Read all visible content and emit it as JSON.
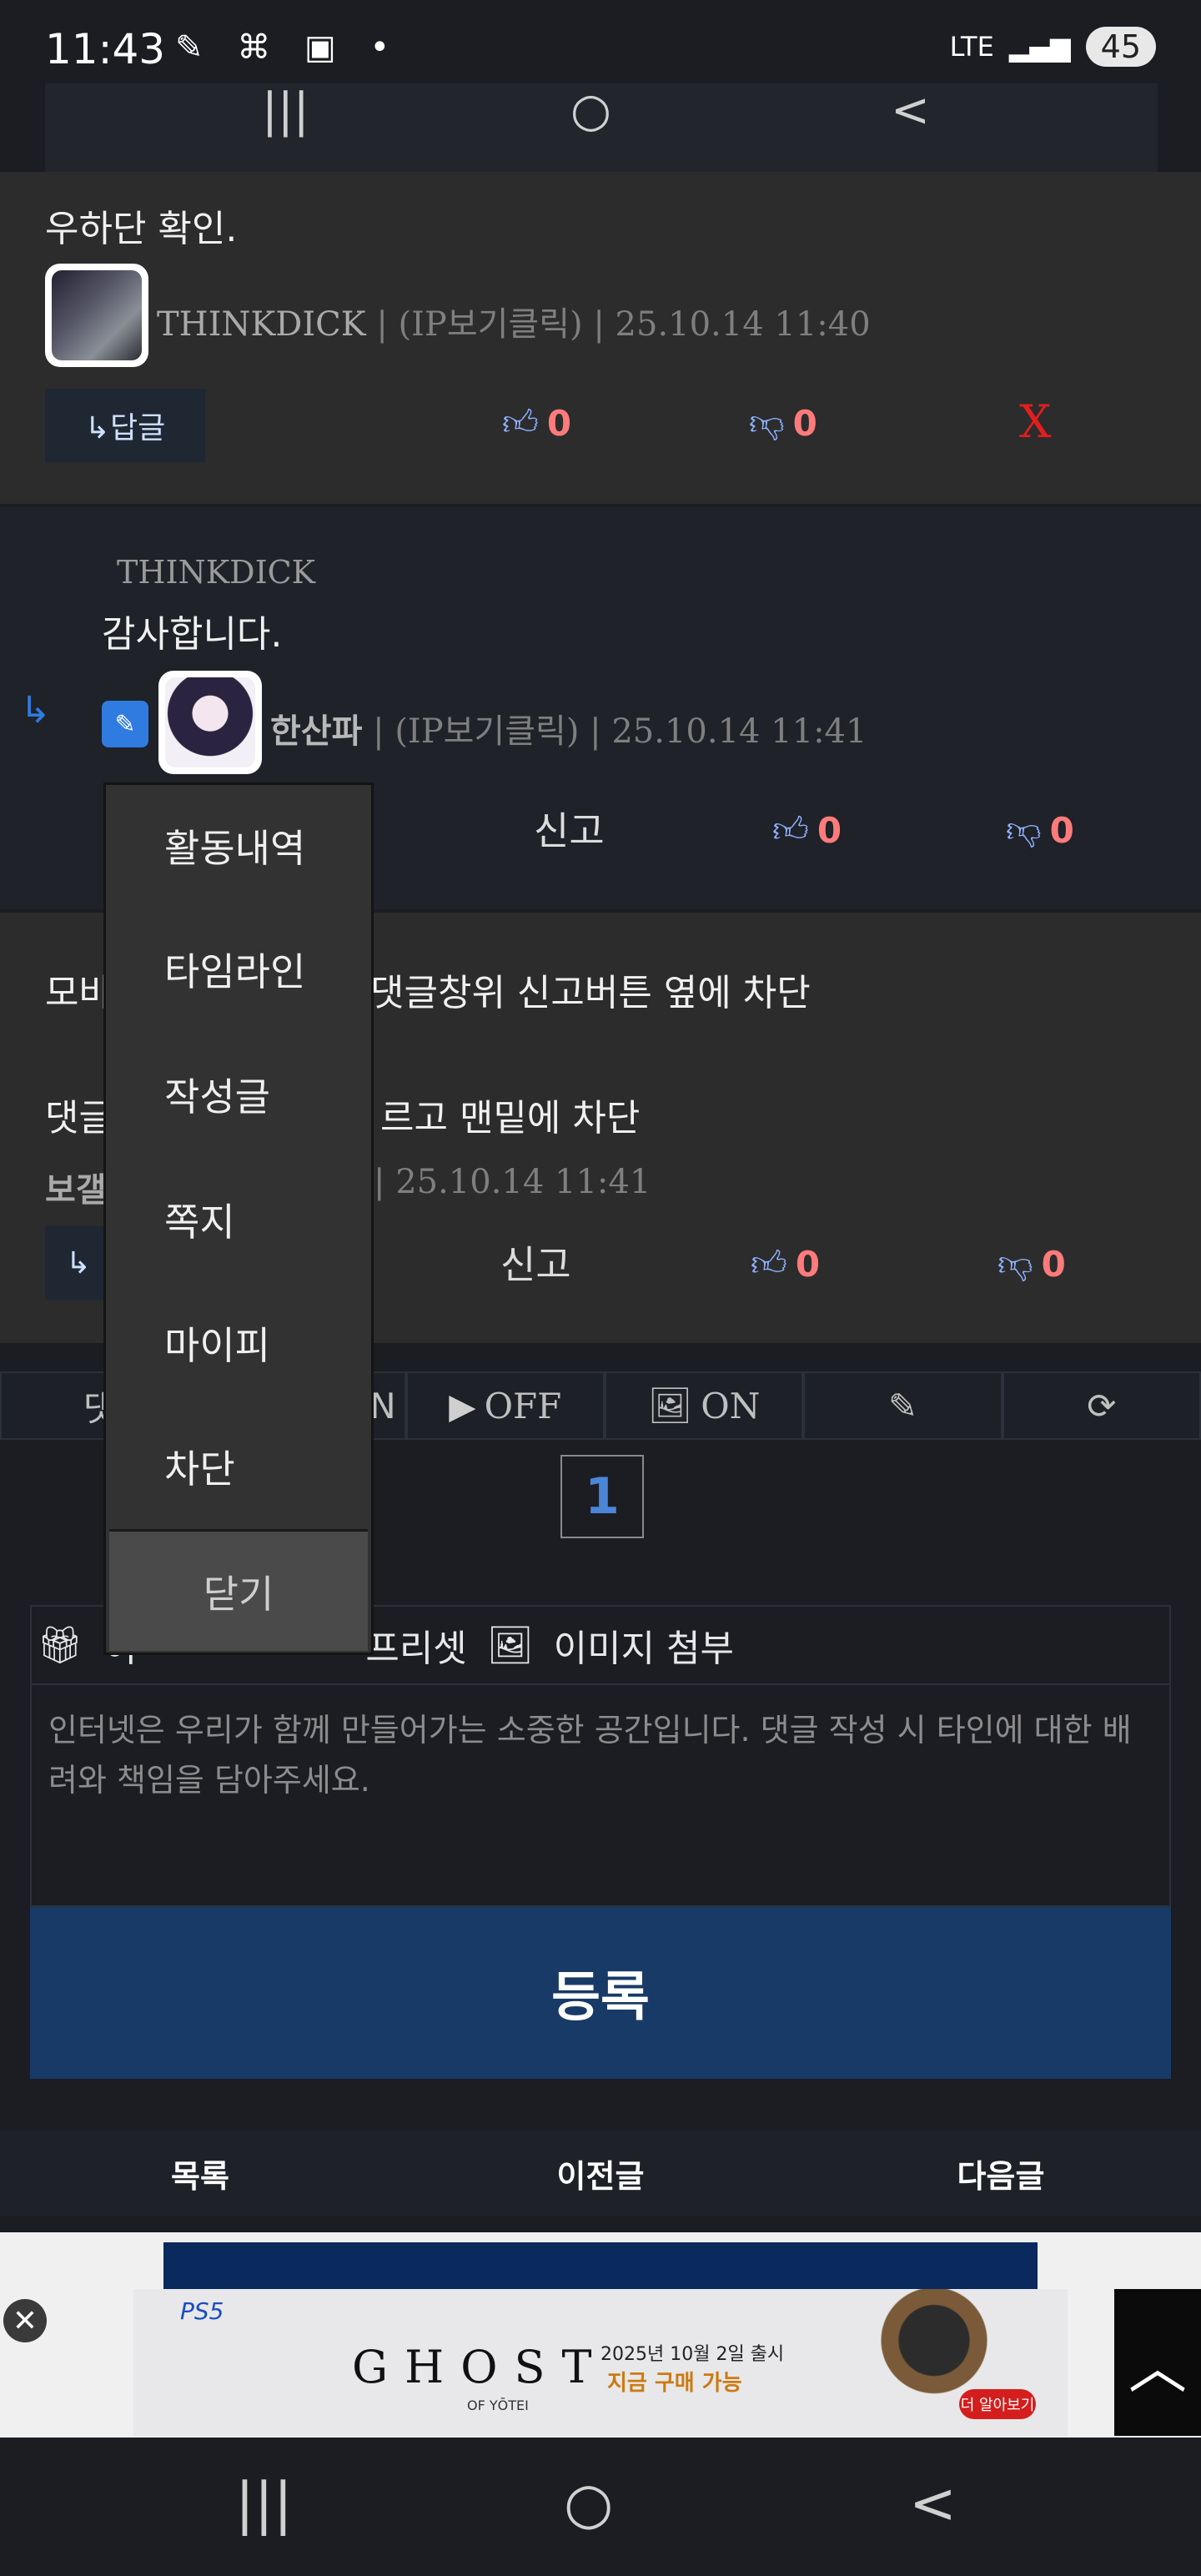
{
  "status_bar": {
    "time": "11:43",
    "network": "LTE",
    "battery": "45"
  },
  "inner_nav": {
    "recents": "|||",
    "home": "○",
    "back": "<"
  },
  "comments": [
    {
      "text": "우하단 확인.",
      "author": "THINKDICK",
      "meta": " | (IP보기클릭) | 25.10.14 11:40",
      "reply_label": "↳답글",
      "likes": "0",
      "dislikes": "0",
      "delete_label": "X"
    },
    {
      "quoted_author": "THINKDICK",
      "text": "감사합니다.",
      "author": "한산파",
      "meta": " | (IP보기클릭) | 25.10.14 11:41",
      "report_label": "신고",
      "likes": "0",
      "dislikes": "0"
    },
    {
      "text_line1_start": "모바",
      "text_line1_end": "댓글창위 신고버튼 옆에 차단",
      "text_line2_start": "댓글",
      "text_line2_end": "르고 맨밑에 차단",
      "author_partial": "보갤",
      "meta": " | 25.10.14 11:41",
      "reply_label": "↳",
      "report_label": "신고",
      "likes": "0",
      "dislikes": "0"
    }
  ],
  "toolbar": {
    "items": [
      "댓",
      "N",
      "OFF",
      "ON",
      "",
      ""
    ],
    "video_label": "OFF",
    "image_label": "ON"
  },
  "pager": {
    "current": "1"
  },
  "write": {
    "tool1": "이",
    "tool2": "프리셋",
    "tool3": "이미지 첨부",
    "placeholder": "인터넷은 우리가 함께 만들어가는 소중한 공간입니다. 댓글 작성 시 타인에 대한 배려와 책임을 담아주세요.",
    "submit_label": "등록"
  },
  "bottom_nav": {
    "list": "목록",
    "prev": "이전글",
    "next": "다음글"
  },
  "ad": {
    "brand": "PS5",
    "title": "GHOST",
    "subtitle": "OF YŌTEI",
    "release": "2025년 10월 2일 출시",
    "promo": "지금 구매 가능",
    "cta": "더 알아보기"
  },
  "popup_menu": {
    "items": [
      "활동내역",
      "타임라인",
      "작성글",
      "쪽지",
      "마이피",
      "차단"
    ],
    "close_label": "닫기"
  },
  "colors": {
    "accent": "#183a66",
    "vote_red": "#ff7b7b",
    "vote_icon": "#8fb0ff",
    "delete_red": "#e31e1e"
  }
}
